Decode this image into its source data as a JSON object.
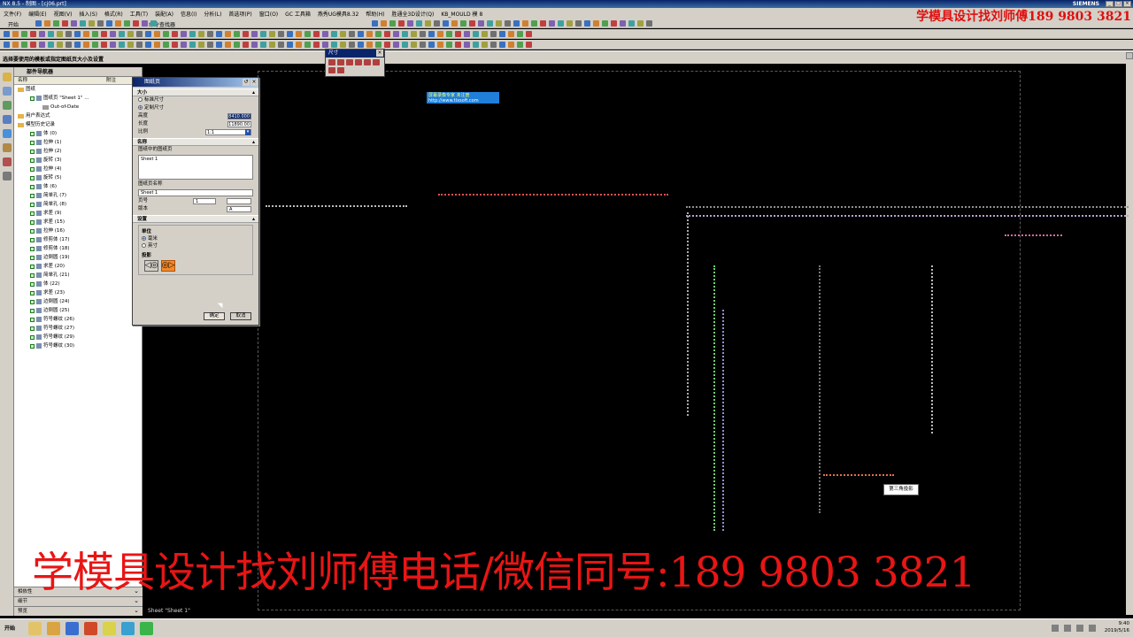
{
  "window": {
    "title": "NX 8.5 - 制图 - [cj06.prt]",
    "brand": "SIEMENS"
  },
  "menu": [
    "文件(F)",
    "编辑(E)",
    "视图(V)",
    "插入(S)",
    "格式(R)",
    "工具(T)",
    "装配(A)",
    "信息(I)",
    "分析(L)",
    "首选项(P)",
    "窗口(O)",
    "GC 工具箱",
    "燕秀UG模具8.32",
    "帮助(H)",
    "胜通全3D设计(Q)",
    "KB_MOULD 模 8"
  ],
  "toolbar": {
    "start_label": "开始",
    "command_search": "命令查找器"
  },
  "prompt": {
    "text": "选择要使用的模板或指定图纸页大小及设置"
  },
  "watermark": {
    "top": "学模具设计找刘师傅189  9803  3821",
    "bottom": "学模具设计找刘师傅电话/微信同号:189  9803  3821"
  },
  "navigator": {
    "title": "部件导航器",
    "columns": [
      "名称",
      "附注"
    ],
    "items": [
      {
        "label": "图纸",
        "indent": 0,
        "type": "folder"
      },
      {
        "label": "图纸页 \"Sheet 1\" ...",
        "indent": 1,
        "type": "sheet"
      },
      {
        "label": "Out-of-Date",
        "indent": 2,
        "type": "item"
      },
      {
        "label": "用户表达式",
        "indent": 0,
        "type": "folder"
      },
      {
        "label": "模型历史记录",
        "indent": 0,
        "type": "folder"
      },
      {
        "label": "体 (0)",
        "indent": 1,
        "type": "feature"
      },
      {
        "label": "拉伸 (1)",
        "indent": 1,
        "type": "feature"
      },
      {
        "label": "拉伸 (2)",
        "indent": 1,
        "type": "feature"
      },
      {
        "label": "旋转 (3)",
        "indent": 1,
        "type": "feature"
      },
      {
        "label": "拉伸 (4)",
        "indent": 1,
        "type": "feature"
      },
      {
        "label": "旋转 (5)",
        "indent": 1,
        "type": "feature"
      },
      {
        "label": "体 (6)",
        "indent": 1,
        "type": "feature"
      },
      {
        "label": "简单孔 (7)",
        "indent": 1,
        "type": "feature"
      },
      {
        "label": "简单孔 (8)",
        "indent": 1,
        "type": "feature"
      },
      {
        "label": "求差 (9)",
        "indent": 1,
        "type": "feature"
      },
      {
        "label": "求差 (15)",
        "indent": 1,
        "type": "feature"
      },
      {
        "label": "拉伸 (16)",
        "indent": 1,
        "type": "feature"
      },
      {
        "label": "修剪体 (17)",
        "indent": 1,
        "type": "feature"
      },
      {
        "label": "修剪体 (18)",
        "indent": 1,
        "type": "feature"
      },
      {
        "label": "边倒圆 (19)",
        "indent": 1,
        "type": "feature"
      },
      {
        "label": "求差 (20)",
        "indent": 1,
        "type": "feature"
      },
      {
        "label": "简单孔 (21)",
        "indent": 1,
        "type": "feature"
      },
      {
        "label": "体 (22)",
        "indent": 1,
        "type": "feature"
      },
      {
        "label": "求差 (23)",
        "indent": 1,
        "type": "feature"
      },
      {
        "label": "边倒圆 (24)",
        "indent": 1,
        "type": "feature"
      },
      {
        "label": "边倒圆 (25)",
        "indent": 1,
        "type": "feature"
      },
      {
        "label": "符号螺纹 (26)",
        "indent": 1,
        "type": "feature"
      },
      {
        "label": "符号螺纹 (27)",
        "indent": 1,
        "type": "feature"
      },
      {
        "label": "符号螺纹 (29)",
        "indent": 1,
        "type": "feature"
      },
      {
        "label": "符号螺纹 (30)",
        "indent": 1,
        "type": "feature"
      }
    ],
    "bottom_panels": [
      "相依性",
      "细节",
      "预览"
    ]
  },
  "dim_toolbar": {
    "title": "尺寸"
  },
  "ad_banner": {
    "line1": "屏幕录像专家      未注册",
    "line2": "http://www.tlxsoft.com"
  },
  "dialog": {
    "title": "图纸页",
    "size_section": "大小",
    "size_options": [
      "标准尺寸",
      "定制尺寸"
    ],
    "size_selected": "定制尺寸",
    "height_label": "高度",
    "height_value": "8410.000",
    "length_label": "长度",
    "length_value": "11890.00",
    "scale_label": "比例",
    "scale_value": "1:1",
    "name_section": "名称",
    "sheets_in_drawing_label": "图纸中的图纸页",
    "sheets_list": [
      "Sheet 1"
    ],
    "sheet_name_label": "图纸页名称",
    "sheet_name_value": "Sheet 1",
    "page_number_label": "页号",
    "page_number_value": "1",
    "revision_label": "版本",
    "revision_value": "A",
    "settings_section": "设置",
    "units_label": "单位",
    "units_options": [
      "毫米",
      "英寸"
    ],
    "units_selected": "毫米",
    "projection_label": "投影",
    "ok_label": "确定",
    "cancel_label": "取消"
  },
  "tooltip": {
    "text": "第三角投影"
  },
  "canvas": {
    "sheet_label": "Sheet \"Sheet 1\""
  },
  "tray": {
    "time": "9:40",
    "date": "2019/5/16"
  }
}
